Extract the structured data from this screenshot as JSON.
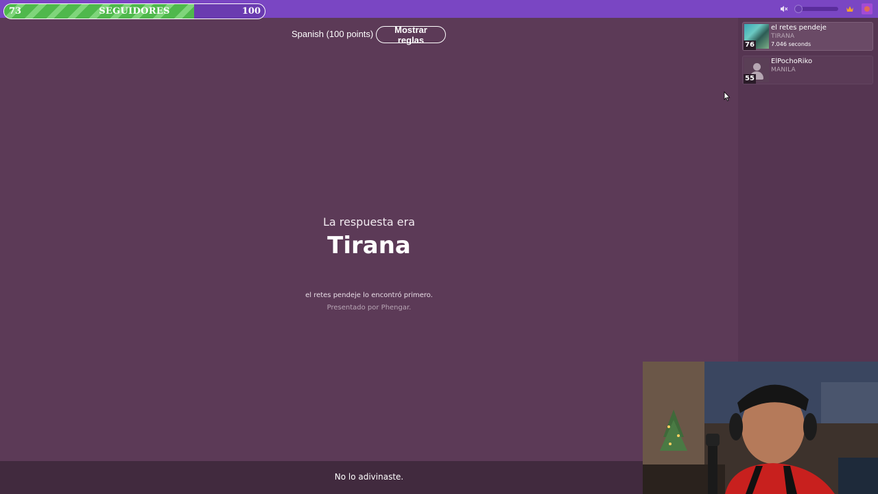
{
  "follower_goal": {
    "current": "73",
    "label": "SEGUIDORES",
    "target": "100",
    "progress_fraction": 0.73
  },
  "top_icons": {
    "mute": "muted-speaker-icon",
    "volume": "volume-slider",
    "crown": "crown-icon",
    "profile": "profile-icon"
  },
  "game": {
    "language_label": "Spanish (100 points)",
    "rules_button": "Mostrar reglas",
    "answer_intro": "La respuesta era",
    "answer": "Tirana",
    "finder_message": "el retes pendeje lo encontró primero.",
    "presented_by": "Presentado por Phengar.",
    "bottom_message": "No lo adivinaste."
  },
  "players": [
    {
      "name": "el retes pendeje",
      "guess": "TIRANA",
      "time": "7.046 seconds",
      "score": "76"
    },
    {
      "name": "ElPochoRiko",
      "guess": "MANILA",
      "score": "55"
    }
  ],
  "colors": {
    "background": "#5c3a57",
    "topbar": "#7a46c3",
    "sidebar": "#553551",
    "progress_green": "#4fb84c",
    "bottom_bar": "#412a3e"
  }
}
